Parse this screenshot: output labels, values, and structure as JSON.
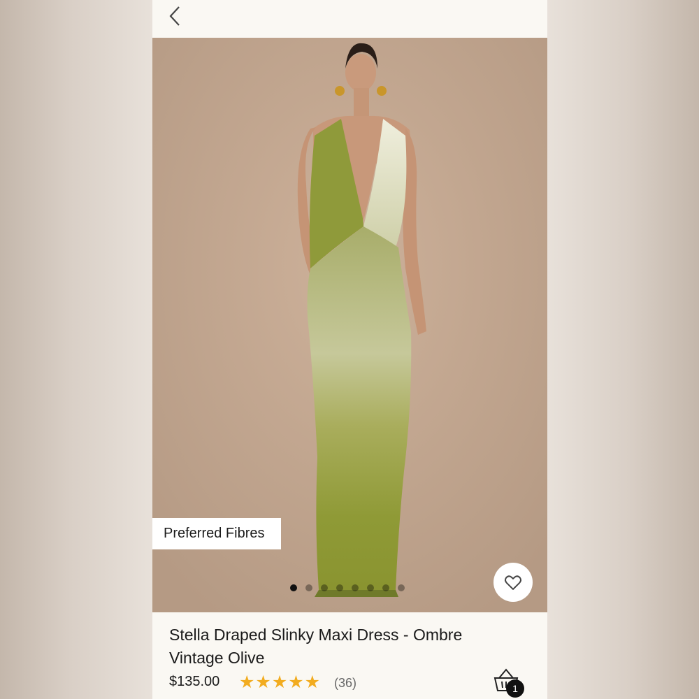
{
  "header": {
    "back_icon": "chevron-left-icon"
  },
  "hero": {
    "badge_label": "Preferred Fibres",
    "favorite_icon": "heart-outline-icon",
    "carousel": {
      "total_slides": 8,
      "active_slide": 1
    }
  },
  "product": {
    "title": "Stella Draped Slinky Maxi Dress - Ombre Vintage Olive",
    "price": "$135.00",
    "rating": 5,
    "stars": "★★★★★",
    "review_count": "(36)"
  },
  "cart": {
    "icon": "shopping-basket-icon",
    "count": "1"
  },
  "colors": {
    "star": "#f2ac20",
    "background": "#faf8f3",
    "dress_olive": "#8a9233",
    "dress_cream": "#e8e3c8"
  }
}
